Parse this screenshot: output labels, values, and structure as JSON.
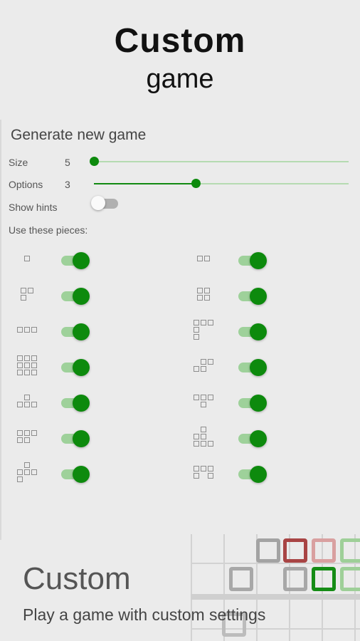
{
  "header": {
    "title_line1": "Custom",
    "title_line2": "game"
  },
  "panel": {
    "title": "Generate new game",
    "size": {
      "label": "Size",
      "value": "5",
      "level": 0.0
    },
    "options": {
      "label": "Options",
      "value": "3",
      "level": 0.4
    },
    "show_hints": {
      "label": "Show hints",
      "on": false
    },
    "pieces_label": "Use these pieces:"
  },
  "pieces": [
    {
      "name": "piece-monomino",
      "on": true
    },
    {
      "name": "piece-domino",
      "on": true
    },
    {
      "name": "piece-l-tromino",
      "on": true
    },
    {
      "name": "piece-square-tetromino",
      "on": true
    },
    {
      "name": "piece-i-tromino",
      "on": true
    },
    {
      "name": "piece-l-tetromino",
      "on": true
    },
    {
      "name": "piece-square-nonomino",
      "on": true
    },
    {
      "name": "piece-s-tetromino",
      "on": true
    },
    {
      "name": "piece-t-tetromino-up",
      "on": true
    },
    {
      "name": "piece-t-tetromino-down",
      "on": true
    },
    {
      "name": "piece-p-pentomino",
      "on": true
    },
    {
      "name": "piece-plus-pentomino",
      "on": true
    },
    {
      "name": "piece-t-pentomino",
      "on": true
    },
    {
      "name": "piece-u-pentomino",
      "on": true
    }
  ],
  "footer": {
    "title": "Custom",
    "subtitle": "Play a game with custom settings"
  },
  "colors": {
    "accent": "#0d8a0d",
    "accent_light": "#9ed19a",
    "background": "#ebebeb"
  }
}
